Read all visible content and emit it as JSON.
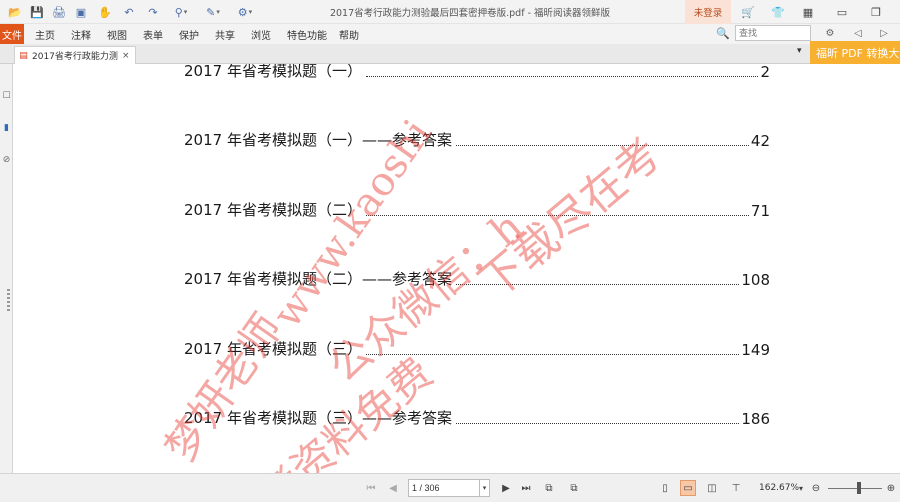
{
  "window": {
    "title": "2017省考行政能力测验最后四套密押卷版.pdf - 福昕阅读器领鲜版",
    "login_label": "未登录"
  },
  "menu": {
    "file": "文件",
    "items": [
      "主页",
      "注释",
      "视图",
      "表单",
      "保护",
      "共享",
      "浏览",
      "特色功能",
      "帮助"
    ],
    "search_placeholder": "查找"
  },
  "tab": {
    "label": "2017省考行政能力测...",
    "close": "×"
  },
  "promo": "福昕 PDF 转换大师",
  "toc": [
    {
      "title": "2017 年省考模拟题（一）",
      "page": "2"
    },
    {
      "title": "2017 年省考模拟题（一）——参考答案",
      "page": "42"
    },
    {
      "title": "2017 年省考模拟题（二）",
      "page": "71"
    },
    {
      "title": "2017 年省考模拟题（二）——参考答案",
      "page": "108"
    },
    {
      "title": "2017 年省考模拟题（三）",
      "page": "149"
    },
    {
      "title": "2017 年省考模拟题（三）——参考答案",
      "page": "186"
    }
  ],
  "watermark": {
    "line1": "www.kaoshi",
    "line2": "公众微信：h",
    "line3": "下载尽在考",
    "line4": "梦妍老师",
    "line5": "考资料免费"
  },
  "status": {
    "page_display": "1 / 306",
    "zoom": "162.67%"
  },
  "icons": {
    "open": "📂",
    "save": "💾",
    "print": "🖨",
    "screen": "▣",
    "hand": "✋",
    "undo": "↶",
    "redo": "↷",
    "stamp": "⚲",
    "pen": "✎",
    "tools": "⚙",
    "cart": "🛒",
    "shirt": "👕",
    "grid": "▦",
    "minimize": "▭",
    "restore": "❐",
    "search": "🔍",
    "gear": "⚙",
    "back": "◁",
    "forward": "▷",
    "pdf": "▤",
    "chevron_down": "▾",
    "first": "⏮",
    "prev": "◀",
    "next": "▶",
    "last": "⏭",
    "copy": "⧉",
    "paste": "⧉",
    "single": "▯",
    "continuous": "▭",
    "facing": "◫",
    "split": "⊤",
    "zoom_out": "⊖",
    "zoom_in": "⊕",
    "bookmark": "☐",
    "layers": "▮",
    "attach": "⊘"
  }
}
